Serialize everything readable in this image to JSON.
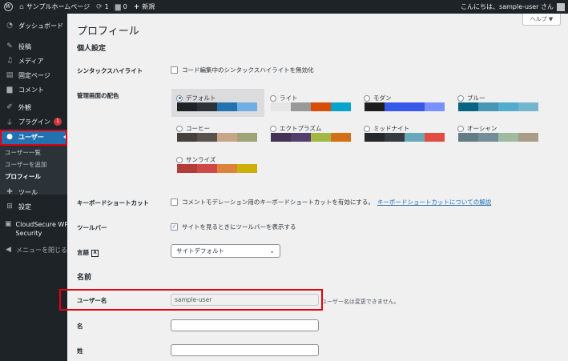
{
  "adminbar": {
    "site_name": "サンプルホームページ",
    "updates_count": "1",
    "comments_count": "0",
    "new_label": "新規",
    "greeting": "こんにちは、sample-user さん"
  },
  "sidebar": {
    "items": [
      {
        "label": "ダッシュボード",
        "icon": "gauge-icon"
      },
      {
        "label": "投稿",
        "icon": "pin-icon"
      },
      {
        "label": "メディア",
        "icon": "media-icon"
      },
      {
        "label": "固定ページ",
        "icon": "page-icon"
      },
      {
        "label": "コメント",
        "icon": "comment-icon"
      },
      {
        "label": "外観",
        "icon": "brush-icon"
      },
      {
        "label": "プラグイン",
        "icon": "plugin-icon",
        "badge": "1"
      },
      {
        "label": "ユーザー",
        "icon": "user-icon"
      },
      {
        "label": "ツール",
        "icon": "wrench-icon"
      },
      {
        "label": "設定",
        "icon": "settings-icon"
      },
      {
        "label": "CloudSecure WP",
        "label2": "Security",
        "icon": "shield-icon"
      },
      {
        "label": "メニューを閉じる",
        "icon": "collapse-icon"
      }
    ],
    "submenu": [
      "ユーザー一覧",
      "ユーザーを追加",
      "プロフィール"
    ]
  },
  "main": {
    "help_label": "ヘルプ ▼",
    "title": "プロフィール",
    "section_personal": "個人設定",
    "syntax_label": "シンタックスハイライト",
    "syntax_text": "コード編集中のシンタックスハイライトを無効化",
    "color_label": "管理画面の配色",
    "schemes": [
      {
        "name": "デフォルト",
        "colors": [
          "#1d2327",
          "#2c3338",
          "#2271b1",
          "#72aee6"
        ],
        "selected": true
      },
      {
        "name": "ライト",
        "colors": [
          "#e5e5e5",
          "#999999",
          "#d64e07",
          "#04a4cc"
        ]
      },
      {
        "name": "モダン",
        "colors": [
          "#1e1e1e",
          "#3858e9",
          "#33f078",
          "#7b90ff"
        ]
      },
      {
        "name": "ブルー",
        "colors": [
          "#096484",
          "#4796b3",
          "#52accc",
          "#74b6ce"
        ]
      },
      {
        "name": "コーヒー",
        "colors": [
          "#46403c",
          "#59524c",
          "#c7a589",
          "#9ea476"
        ]
      },
      {
        "name": "エクトプラズム",
        "colors": [
          "#413256",
          "#523f6d",
          "#a3b745",
          "#d46f15"
        ]
      },
      {
        "name": "ミッドナイト",
        "colors": [
          "#25282b",
          "#363b3f",
          "#69a8bb",
          "#e14d43"
        ]
      },
      {
        "name": "オーシャン",
        "colors": [
          "#627c83",
          "#738e96",
          "#9ebaa0",
          "#aa9d88"
        ]
      },
      {
        "name": "サンライズ",
        "colors": [
          "#b43c38",
          "#cf4944",
          "#dd823b",
          "#ccaf0b"
        ]
      }
    ],
    "keyboard_label": "キーボードショートカット",
    "keyboard_text": "コメントモデレーション用のキーボードショートカットを有効にする。",
    "keyboard_link": "キーボードショートカットについての解説",
    "toolbar_label": "ツールバー",
    "toolbar_text": "サイトを見るときにツールバーを表示する",
    "language_label": "言語",
    "language_value": "サイトデフォルト",
    "section_name": "名前",
    "username_label": "ユーザー名",
    "username_value": "sample-user",
    "username_desc": "ユーザー名は変更できません。",
    "firstname_label": "名",
    "lastname_label": "姓"
  }
}
